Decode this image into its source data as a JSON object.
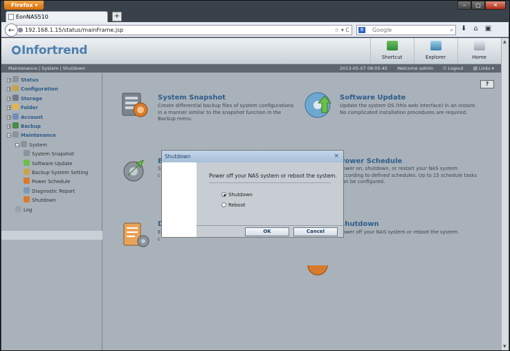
{
  "browser": {
    "menu_label": "Firefox",
    "tab_title": "EonNAS510",
    "new_tab": "+",
    "url": "192.168.1.15/status/mainFrame.jsp",
    "search_placeholder": "Google",
    "window_controls": {
      "minimize": "‒",
      "maximize": "□",
      "close": "✕"
    }
  },
  "app": {
    "logo": "Infortrend",
    "header_buttons": [
      {
        "label": "Shortcut",
        "icon": "shortcut-icon"
      },
      {
        "label": "Explorer",
        "icon": "explorer-icon"
      },
      {
        "label": "Home",
        "icon": "home-icon"
      }
    ],
    "status": {
      "breadcrumb": "Maintenance | System | Shutdown",
      "datetime": "2013-05-07 08:05:45",
      "welcome": "Welcome admin",
      "logout": "Logout",
      "links": "Links ▾"
    }
  },
  "sidebar": {
    "items": [
      {
        "label": "Status",
        "level": 0,
        "pm": "+"
      },
      {
        "label": "Configuration",
        "level": 0,
        "pm": "+"
      },
      {
        "label": "Storage",
        "level": 0,
        "pm": "+"
      },
      {
        "label": "Folder",
        "level": 0,
        "pm": "+"
      },
      {
        "label": "Account",
        "level": 0,
        "pm": "+"
      },
      {
        "label": "Backup",
        "level": 0,
        "pm": "+"
      },
      {
        "label": "Maintenance",
        "level": 0,
        "pm": "−"
      },
      {
        "label": "System",
        "level": 1,
        "pm": "−"
      },
      {
        "label": "System Snapshot",
        "level": 2
      },
      {
        "label": "Software Update",
        "level": 2
      },
      {
        "label": "Backup System Setting",
        "level": 2
      },
      {
        "label": "Power Schedule",
        "level": 2
      },
      {
        "label": "Diagnostic Report",
        "level": 2
      },
      {
        "label": "Shutdown",
        "level": 2,
        "selected": true
      },
      {
        "label": "Log",
        "level": 1
      }
    ]
  },
  "main": {
    "help": "?",
    "cards": [
      {
        "title": "System Snapshot",
        "desc": "Create differential backup files of system configurations in a manner similar to the snapshot function in the Backup menu."
      },
      {
        "title": "Software Update",
        "desc": "Update the system OS (this web interface) in an instant. No complicated installation procedures are required."
      },
      {
        "title": "Power Schedule",
        "desc": "Power on, shutdown, or restart your NAS system according to defined schedules. Up to 15 schedule tasks can be configured."
      },
      {
        "title": "Shutdown",
        "desc": "Power off your NAS system or reboot the system."
      }
    ],
    "partial_labels": {
      "backup_letter": "B",
      "diag_letter": "D",
      "backup_desc": "S",
      "backup_desc2": "c",
      "diag_desc": "E",
      "diag_desc2": "c"
    }
  },
  "dialog": {
    "title": "Shutdown",
    "close": "×",
    "message": "Power off your NAS system or reboot the system.",
    "options": [
      {
        "label": "Shutdown",
        "selected": true
      },
      {
        "label": "Reboot",
        "selected": false
      }
    ],
    "ok": "OK",
    "cancel": "Cancel"
  }
}
